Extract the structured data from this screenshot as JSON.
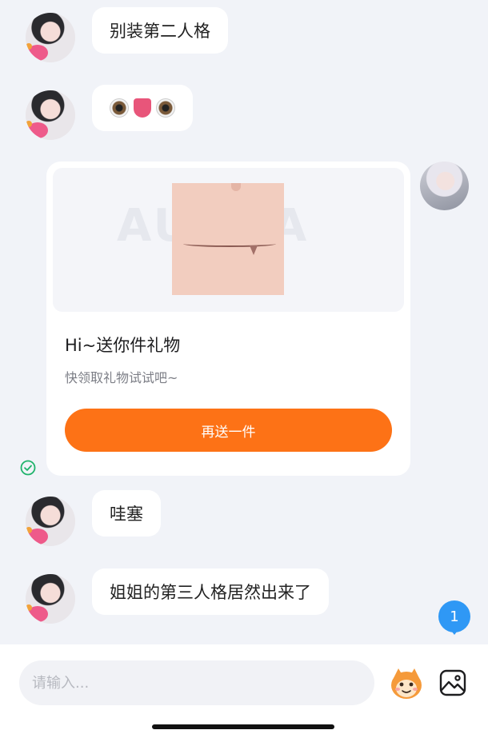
{
  "messages": [
    {
      "side": "left",
      "text": "别装第二人格"
    },
    {
      "side": "left",
      "emoji": [
        "eyes-left",
        "tongue",
        "eyes-right"
      ]
    },
    {
      "side": "left",
      "text": "哇塞"
    },
    {
      "side": "left",
      "text": "姐姐的第三人格居然出来了"
    }
  ],
  "gift_card": {
    "watermark": "AUORA",
    "title": "Hi~送你件礼物",
    "subtitle": "快领取礼物试试吧~",
    "button_label": "再送一件"
  },
  "unread_count": "1",
  "composer": {
    "placeholder": "请输入..."
  },
  "colors": {
    "accent_orange": "#fd7216",
    "badge_blue": "#2f98f5",
    "check_green": "#1fb36b",
    "background": "#f1f3f8"
  }
}
